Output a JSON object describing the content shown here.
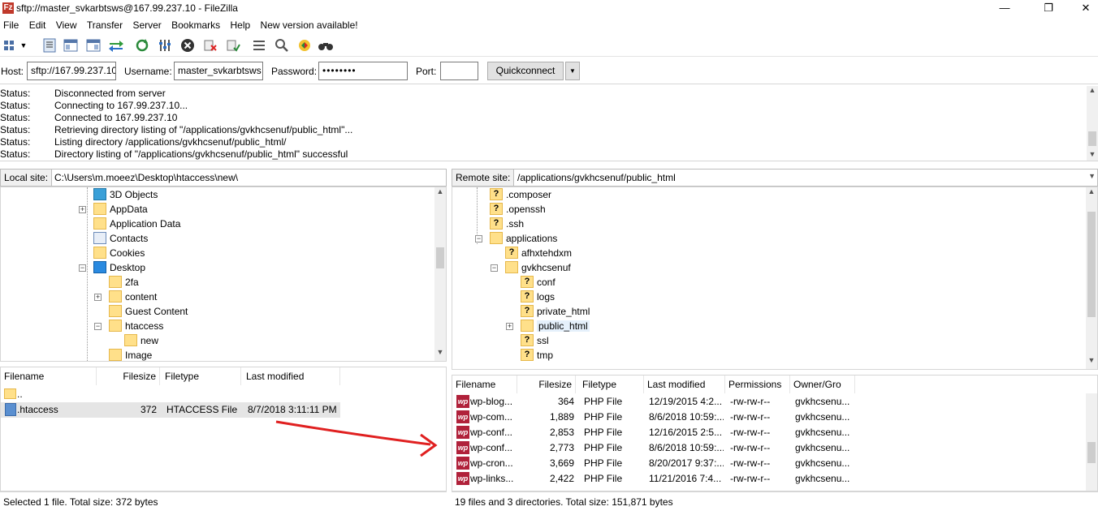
{
  "window": {
    "title": "sftp://master_svkarbtsws@167.99.237.10 - FileZilla",
    "app_icon": "Fz",
    "controls": {
      "minimize": "—",
      "maximize": "❐",
      "close": "✕"
    }
  },
  "menu": [
    "File",
    "Edit",
    "View",
    "Transfer",
    "Server",
    "Bookmarks",
    "Help",
    "New version available!"
  ],
  "toolbar_icons": [
    "site-manager-icon",
    "dropdown-icon",
    "toggle-log-icon",
    "toggle-local-tree-icon",
    "toggle-remote-tree-icon",
    "toggle-queue-icon",
    "refresh-icon",
    "process-queue-icon",
    "cancel-icon",
    "disconnect-icon",
    "reconnect-icon",
    "filter-icon",
    "search-icon",
    "compare-icon",
    "find-icon"
  ],
  "quickconnect": {
    "host_label": "Host:",
    "host_value": "sftp://167.99.237.10",
    "username_label": "Username:",
    "username_value": "master_svkarbtsws",
    "password_label": "Password:",
    "password_value": "••••••••",
    "port_label": "Port:",
    "port_value": "",
    "button_label": "Quickconnect",
    "dropdown": "▼"
  },
  "log": [
    {
      "k": "Status:",
      "v": "Disconnected from server"
    },
    {
      "k": "Status:",
      "v": "Connecting to 167.99.237.10..."
    },
    {
      "k": "Status:",
      "v": "Connected to 167.99.237.10"
    },
    {
      "k": "Status:",
      "v": "Retrieving directory listing of \"/applications/gvkhcsenuf/public_html\"..."
    },
    {
      "k": "Status:",
      "v": "Listing directory /applications/gvkhcsenuf/public_html/"
    },
    {
      "k": "Status:",
      "v": "Directory listing of \"/applications/gvkhcsenuf/public_html\" successful"
    }
  ],
  "local": {
    "site_label": "Local site:",
    "path": "C:\\Users\\m.moeez\\Desktop\\htaccess\\new\\",
    "tree": [
      {
        "name": "3D Objects",
        "indent": 0,
        "icon": "objects"
      },
      {
        "name": "AppData",
        "indent": 0,
        "icon": "folder",
        "exp": "+"
      },
      {
        "name": "Application Data",
        "indent": 0,
        "icon": "folder"
      },
      {
        "name": "Contacts",
        "indent": 0,
        "icon": "contacts"
      },
      {
        "name": "Cookies",
        "indent": 0,
        "icon": "folder"
      },
      {
        "name": "Desktop",
        "indent": 0,
        "icon": "desktop",
        "exp": "−"
      },
      {
        "name": "2fa",
        "indent": 1,
        "icon": "folder"
      },
      {
        "name": "content",
        "indent": 1,
        "icon": "folder",
        "exp": "+"
      },
      {
        "name": "Guest Content",
        "indent": 1,
        "icon": "folder"
      },
      {
        "name": "htaccess",
        "indent": 1,
        "icon": "folder",
        "exp": "−"
      },
      {
        "name": "new",
        "indent": 2,
        "icon": "folder"
      },
      {
        "name": "Image",
        "indent": 1,
        "icon": "folder"
      }
    ],
    "columns": [
      "Filename",
      "Filesize",
      "Filetype",
      "Last modified"
    ],
    "files": [
      {
        "name": "..",
        "size": "",
        "type": "",
        "modified": "",
        "icon": "folder"
      },
      {
        "name": ".htaccess",
        "size": "372",
        "type": "HTACCESS File",
        "modified": "8/7/2018 3:11:11 PM",
        "icon": "file"
      }
    ],
    "status": "Selected 1 file. Total size: 372 bytes"
  },
  "remote": {
    "site_label": "Remote site:",
    "path": "/applications/gvkhcsenuf/public_html",
    "tree": [
      {
        "name": ".composer",
        "indent": 0,
        "icon": "q"
      },
      {
        "name": ".openssh",
        "indent": 0,
        "icon": "q"
      },
      {
        "name": ".ssh",
        "indent": 0,
        "icon": "q"
      },
      {
        "name": "applications",
        "indent": 0,
        "icon": "folder",
        "exp": "−"
      },
      {
        "name": "afhxtehdxm",
        "indent": 1,
        "icon": "q"
      },
      {
        "name": "gvkhcsenuf",
        "indent": 1,
        "icon": "folder",
        "exp": "−"
      },
      {
        "name": "conf",
        "indent": 2,
        "icon": "q"
      },
      {
        "name": "logs",
        "indent": 2,
        "icon": "q"
      },
      {
        "name": "private_html",
        "indent": 2,
        "icon": "q"
      },
      {
        "name": "public_html",
        "indent": 2,
        "icon": "folder",
        "exp": "+",
        "selected": true
      },
      {
        "name": "ssl",
        "indent": 2,
        "icon": "q"
      },
      {
        "name": "tmp",
        "indent": 2,
        "icon": "q"
      }
    ],
    "columns": [
      "Filename",
      "Filesize",
      "Filetype",
      "Last modified",
      "Permissions",
      "Owner/Gro"
    ],
    "files": [
      {
        "name": "wp-blog...",
        "size": "364",
        "type": "PHP File",
        "modified": "12/19/2015 4:2...",
        "perm": "-rw-rw-r--",
        "owner": "gvkhcsenu..."
      },
      {
        "name": "wp-com...",
        "size": "1,889",
        "type": "PHP File",
        "modified": "8/6/2018 10:59:...",
        "perm": "-rw-rw-r--",
        "owner": "gvkhcsenu..."
      },
      {
        "name": "wp-conf...",
        "size": "2,853",
        "type": "PHP File",
        "modified": "12/16/2015 2:5...",
        "perm": "-rw-rw-r--",
        "owner": "gvkhcsenu..."
      },
      {
        "name": "wp-conf...",
        "size": "2,773",
        "type": "PHP File",
        "modified": "8/6/2018 10:59:...",
        "perm": "-rw-rw-r--",
        "owner": "gvkhcsenu..."
      },
      {
        "name": "wp-cron...",
        "size": "3,669",
        "type": "PHP File",
        "modified": "8/20/2017 9:37:...",
        "perm": "-rw-rw-r--",
        "owner": "gvkhcsenu..."
      },
      {
        "name": "wp-links...",
        "size": "2,422",
        "type": "PHP File",
        "modified": "11/21/2016 7:4...",
        "perm": "-rw-rw-r--",
        "owner": "gvkhcsenu..."
      }
    ],
    "status": "19 files and 3 directories. Total size: 151,871 bytes"
  },
  "colors": {
    "annotation_arrow": "#e02020",
    "php_icon": "#b0213a",
    "folder": "#ffe08a"
  }
}
